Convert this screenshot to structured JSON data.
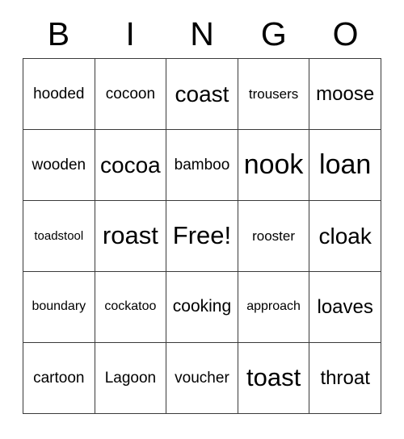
{
  "card": {
    "header_letters": [
      "B",
      "I",
      "N",
      "G",
      "O"
    ],
    "free_space_label": "Free!",
    "colors": {
      "background": "#ffffff",
      "text": "#000000",
      "grid_line": "#3a3a3a"
    },
    "grid": {
      "rows": 5,
      "columns": 5,
      "cells": [
        [
          {
            "text": "hooded",
            "size": "m"
          },
          {
            "text": "cocoon",
            "size": "m"
          },
          {
            "text": "coast",
            "size": "xl"
          },
          {
            "text": "trousers",
            "size": "sm"
          },
          {
            "text": "moose",
            "size": "l"
          }
        ],
        [
          {
            "text": "wooden",
            "size": "m"
          },
          {
            "text": "cocoa",
            "size": "xl"
          },
          {
            "text": "bamboo",
            "size": "m"
          },
          {
            "text": "nook",
            "size": "h"
          },
          {
            "text": "loan",
            "size": "h"
          }
        ],
        [
          {
            "text": "toadstool",
            "size": "xs"
          },
          {
            "text": "roast",
            "size": "xxl"
          },
          {
            "text": "Free!",
            "size": "xxl"
          },
          {
            "text": "rooster",
            "size": "sm"
          },
          {
            "text": "cloak",
            "size": "xl"
          }
        ],
        [
          {
            "text": "boundary",
            "size": "s"
          },
          {
            "text": "cockatoo",
            "size": "s"
          },
          {
            "text": "cooking",
            "size": "ml"
          },
          {
            "text": "approach",
            "size": "s"
          },
          {
            "text": "loaves",
            "size": "l"
          }
        ],
        [
          {
            "text": "cartoon",
            "size": "m"
          },
          {
            "text": "Lagoon",
            "size": "m"
          },
          {
            "text": "voucher",
            "size": "m"
          },
          {
            "text": "toast",
            "size": "xxl"
          },
          {
            "text": "throat",
            "size": "l"
          }
        ]
      ]
    }
  }
}
